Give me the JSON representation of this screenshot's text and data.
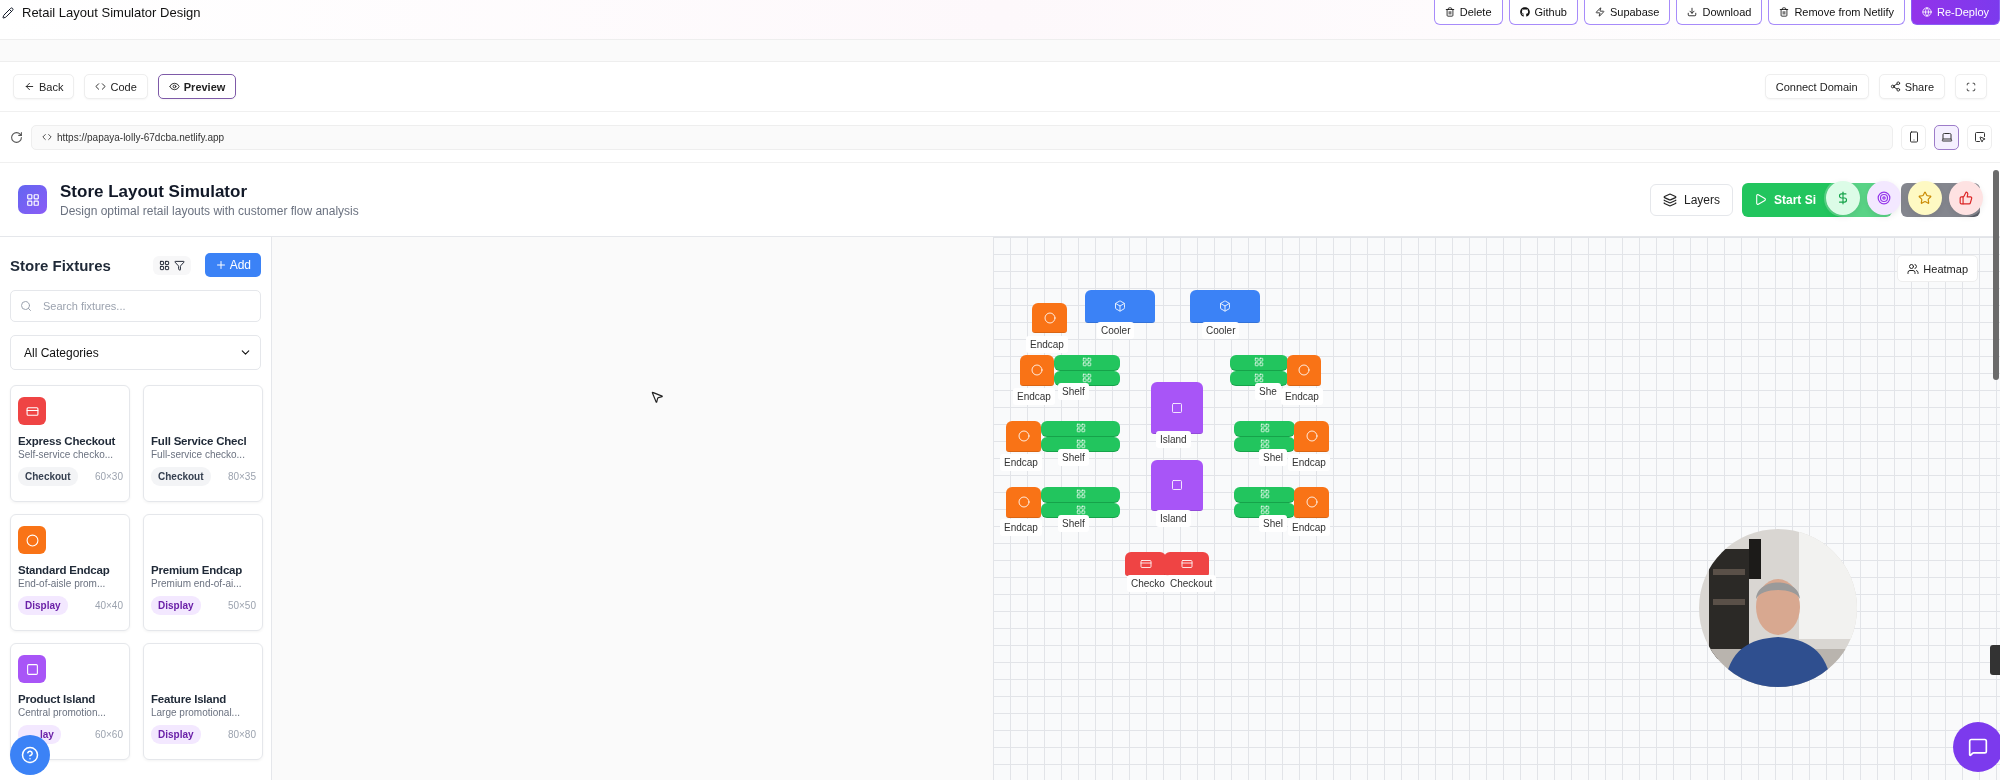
{
  "window": {
    "title": "Retail Layout Simulator Design"
  },
  "top_actions": [
    {
      "label": "Delete",
      "kind": "outline"
    },
    {
      "label": "Github",
      "kind": "outline"
    },
    {
      "label": "Supabase",
      "kind": "outline"
    },
    {
      "label": "Download",
      "kind": "outline"
    },
    {
      "label": "Remove from Netlify",
      "kind": "outline"
    },
    {
      "label": "Re-Deploy",
      "kind": "primary"
    }
  ],
  "back_button": "Back",
  "view_tabs": [
    {
      "label": "Code",
      "selected": false
    },
    {
      "label": "Preview",
      "selected": true
    }
  ],
  "share_actions": [
    "Connect Domain",
    "Share"
  ],
  "address_bar": {
    "url": "https://papaya-lolly-67dcba.netlify.app"
  },
  "device_modes": [
    {
      "selected": false
    },
    {
      "selected": true
    },
    {
      "selected": false
    }
  ],
  "app": {
    "title": "Store Layout Simulator",
    "subtitle": "Design optimal retail layouts with customer flow analysis",
    "layers_button": "Layers",
    "start_button": "Start Si"
  },
  "sidebar": {
    "title": "Store Fixtures",
    "add_button": "Add",
    "search": {
      "placeholder": "Search fixtures..."
    },
    "category_select": {
      "value": "All Categories"
    },
    "fixtures": [
      {
        "name": "Express Checkout",
        "description": "Self-service checko...",
        "category": "Checkout",
        "size": "60×30",
        "kind": "checkout",
        "color": "#ef4444"
      },
      {
        "name": "Full Service Checl",
        "description": "Full-service checko...",
        "category": "Checkout",
        "size": "80×35",
        "kind": "checkout"
      },
      {
        "name": "Standard Endcap",
        "description": "End-of-aisle prom...",
        "category": "Display",
        "size": "40×40",
        "kind": "display",
        "color": "#f97316"
      },
      {
        "name": "Premium Endcap",
        "description": "Premium end-of-ai...",
        "category": "Display",
        "size": "50×50",
        "kind": "display"
      },
      {
        "name": "Product Island",
        "description": "Central promotion...",
        "category": "lay",
        "size": "60×60",
        "kind": "display",
        "color": "#a855f7"
      },
      {
        "name": "Feature Island",
        "description": "Large promotional...",
        "category": "Display",
        "size": "80×80",
        "kind": "display"
      }
    ]
  },
  "canvas": {
    "heatmap_button": "Heatmap",
    "items": [
      {
        "kind": "endcap",
        "label": "Endcap"
      },
      {
        "kind": "cooler",
        "label": "Cooler"
      },
      {
        "kind": "cooler",
        "label": "Cooler"
      },
      {
        "kind": "endcap",
        "label": "Endcap"
      },
      {
        "kind": "shelf",
        "label": "Shelf"
      },
      {
        "kind": "shelf",
        "label": "She"
      },
      {
        "kind": "endcap",
        "label": "Endcap"
      },
      {
        "kind": "island",
        "label": "Island"
      },
      {
        "kind": "endcap",
        "label": "Endcap"
      },
      {
        "kind": "shelf",
        "label": "Shelf"
      },
      {
        "kind": "shelf",
        "label": "Shel"
      },
      {
        "kind": "endcap",
        "label": "Endcap"
      },
      {
        "kind": "island",
        "label": "Island"
      },
      {
        "kind": "endcap",
        "label": "Endcap"
      },
      {
        "kind": "shelf",
        "label": "Shelf"
      },
      {
        "kind": "shelf",
        "label": "Shel"
      },
      {
        "kind": "endcap",
        "label": "Endcap"
      },
      {
        "kind": "checkout",
        "label": "Checko"
      },
      {
        "kind": "checkout",
        "label": "Checkout"
      }
    ]
  }
}
